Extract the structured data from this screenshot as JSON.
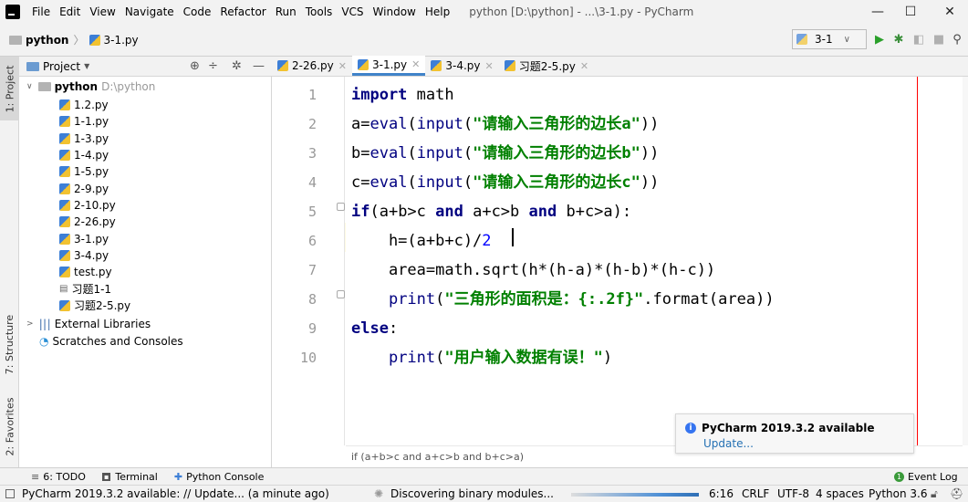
{
  "menubar": {
    "items": [
      "File",
      "Edit",
      "View",
      "Navigate",
      "Code",
      "Refactor",
      "Run",
      "Tools",
      "VCS",
      "Window",
      "Help"
    ],
    "window_title": "python [D:\\python] - ...\\3-1.py - PyCharm",
    "minimize": "—",
    "maximize": "☐",
    "close": "✕"
  },
  "navbar": {
    "breadcrumb": [
      "python",
      "3-1.py"
    ],
    "run_config": "3-1",
    "run_config_caret": "∨"
  },
  "tool_windows": {
    "project": "1: Project",
    "structure": "7: Structure",
    "favorites": "2: Favorites"
  },
  "project": {
    "header_label": "Project",
    "root_name": "python",
    "root_path": "D:\\python",
    "files": [
      "1.2.py",
      "1-1.py",
      "1-3.py",
      "1-4.py",
      "1-5.py",
      "2-9.py",
      "2-10.py",
      "2-26.py",
      "3-1.py",
      "3-4.py",
      "test.py",
      "习题1-1",
      "习题2-5.py"
    ],
    "external_libraries": "External Libraries",
    "scratches": "Scratches and Consoles"
  },
  "tabs": [
    {
      "label": "2-26.py",
      "active": false
    },
    {
      "label": "3-1.py",
      "active": true
    },
    {
      "label": "3-4.py",
      "active": false
    },
    {
      "label": "习题2-5.py",
      "active": false
    }
  ],
  "editor": {
    "line_numbers": [
      "1",
      "2",
      "3",
      "4",
      "5",
      "6",
      "7",
      "8",
      "9",
      "10"
    ],
    "lines": [
      [
        [
          "kw",
          "import"
        ],
        [
          "plain",
          " math"
        ]
      ],
      [
        [
          "plain",
          "a="
        ],
        [
          "bi",
          "eval"
        ],
        [
          "plain",
          "("
        ],
        [
          "bi",
          "input"
        ],
        [
          "plain",
          "("
        ],
        [
          "str",
          "\"请输入三角形的边长a\""
        ],
        [
          "plain",
          "))"
        ]
      ],
      [
        [
          "plain",
          "b="
        ],
        [
          "bi",
          "eval"
        ],
        [
          "plain",
          "("
        ],
        [
          "bi",
          "input"
        ],
        [
          "plain",
          "("
        ],
        [
          "str",
          "\"请输入三角形的边长b\""
        ],
        [
          "plain",
          "))"
        ]
      ],
      [
        [
          "plain",
          "c="
        ],
        [
          "bi",
          "eval"
        ],
        [
          "plain",
          "("
        ],
        [
          "bi",
          "input"
        ],
        [
          "plain",
          "("
        ],
        [
          "str",
          "\"请输入三角形的边长c\""
        ],
        [
          "plain",
          "))"
        ]
      ],
      [
        [
          "kw",
          "if"
        ],
        [
          "plain",
          "(a+b>c "
        ],
        [
          "kw",
          "and"
        ],
        [
          "plain",
          " a+c>b "
        ],
        [
          "kw",
          "and"
        ],
        [
          "plain",
          " b+c>a):"
        ]
      ],
      [
        [
          "plain",
          "    h=(a+b+c)/"
        ],
        [
          "num",
          "2"
        ]
      ],
      [
        [
          "plain",
          "    area=math.sqrt(h*(h-a)*(h-b)*(h-c))"
        ]
      ],
      [
        [
          "plain",
          "    "
        ],
        [
          "bi",
          "print"
        ],
        [
          "plain",
          "("
        ],
        [
          "str",
          "\"三角形的面积是：{:.2f}\""
        ],
        [
          "plain",
          ".format(area))"
        ]
      ],
      [
        [
          "kw",
          "else"
        ],
        [
          "plain",
          ":"
        ]
      ],
      [
        [
          "plain",
          "    "
        ],
        [
          "bi",
          "print"
        ],
        [
          "plain",
          "("
        ],
        [
          "str",
          "\"用户输入数据有误！\""
        ],
        [
          "plain",
          ")"
        ]
      ]
    ],
    "context_breadcrumb": "if (a+b>c and a+c>b and b+c>a)"
  },
  "notification": {
    "title": "PyCharm 2019.3.2 available",
    "link": "Update..."
  },
  "bottom_tools": {
    "todo": "6: TODO",
    "terminal": "Terminal",
    "python_console": "Python Console",
    "event_log": "Event Log"
  },
  "status": {
    "message": "PyCharm 2019.3.2 available: // Update... (a minute ago)",
    "progress": "Discovering binary modules...",
    "position": "6:16",
    "line_sep": "CRLF",
    "encoding": "UTF-8",
    "indent": "4 spaces",
    "interpreter": "Python 3.6"
  },
  "colors": {
    "keyword": "#000080",
    "string": "#008000",
    "number": "#0000ff",
    "caret_row": "#fffae3",
    "tab_accent": "#4083c9",
    "link": "#2470b3"
  }
}
